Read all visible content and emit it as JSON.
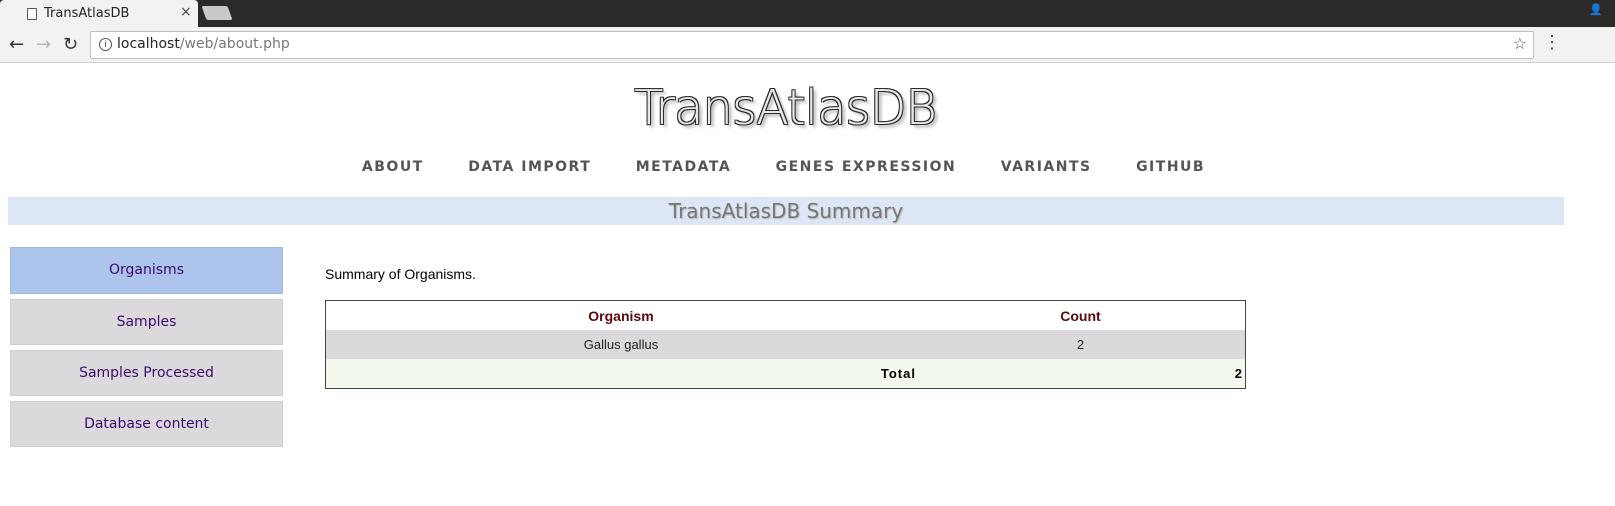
{
  "browser": {
    "tab_title": "TransAtlasDB",
    "tab_close": "×",
    "url_host": "localhost",
    "url_path": "/web/about.php"
  },
  "site": {
    "title": "TransAtlasDB",
    "nav": [
      "ABOUT",
      "DATA IMPORT",
      "METADATA",
      "GENES EXPRESSION",
      "VARIANTS",
      "GITHUB"
    ]
  },
  "summary_heading": "TransAtlasDB Summary",
  "sidebar": {
    "items": [
      "Organisms",
      "Samples",
      "Samples Processed",
      "Database content"
    ],
    "active": "Organisms"
  },
  "main": {
    "caption": "Summary of Organisms.",
    "table": {
      "headers": [
        "Organism",
        "Count"
      ],
      "rows": [
        [
          "Gallus gallus",
          "2"
        ]
      ],
      "total_label": "Total",
      "total_value": "2"
    }
  },
  "colors": {
    "summary_bar": "#dde6f4",
    "sidebar_active": "#adc5ec",
    "sidebar_item": "#dcd9dc",
    "total_row": "#f2f8ec",
    "header_text": "#5a0a0a"
  }
}
